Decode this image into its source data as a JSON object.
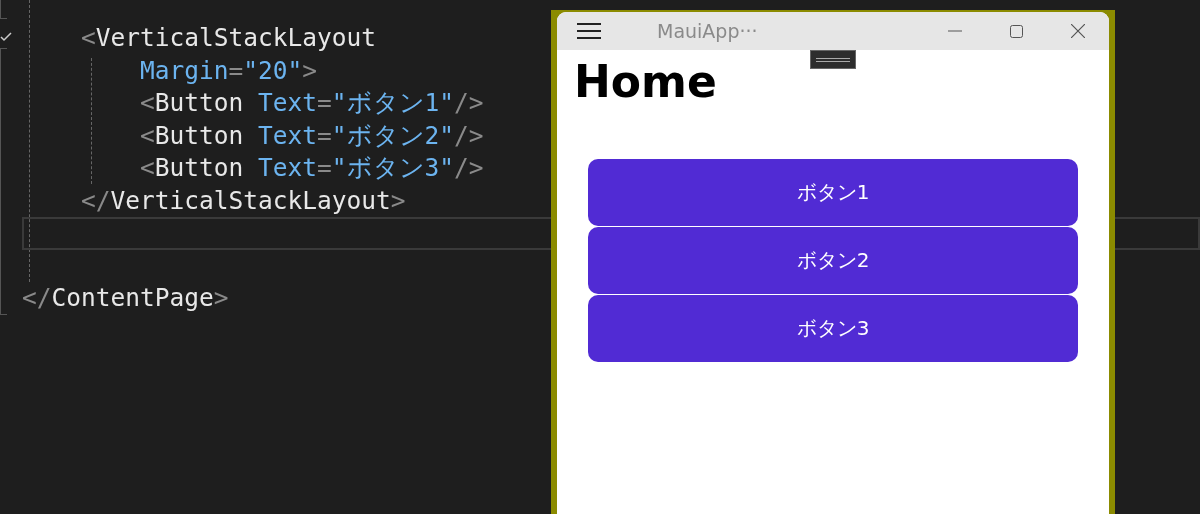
{
  "editor": {
    "lines": [
      {
        "tokens": [
          {
            "kind": "punct",
            "text": "    <"
          },
          {
            "kind": "tag",
            "text": "VerticalStackLayout"
          }
        ]
      },
      {
        "tokens": [
          {
            "kind": "attr",
            "text": "        Margin"
          },
          {
            "kind": "punct",
            "text": "="
          },
          {
            "kind": "value",
            "text": "\"20\""
          },
          {
            "kind": "punct",
            "text": ">"
          }
        ]
      },
      {
        "tokens": [
          {
            "kind": "punct",
            "text": "        <"
          },
          {
            "kind": "tag",
            "text": "Button"
          },
          {
            "kind": "attr",
            "text": " Text"
          },
          {
            "kind": "punct",
            "text": "="
          },
          {
            "kind": "value",
            "text": "\"ボタン1\""
          },
          {
            "kind": "punct",
            "text": "/>"
          }
        ]
      },
      {
        "tokens": [
          {
            "kind": "punct",
            "text": "        <"
          },
          {
            "kind": "tag",
            "text": "Button"
          },
          {
            "kind": "attr",
            "text": " Text"
          },
          {
            "kind": "punct",
            "text": "="
          },
          {
            "kind": "value",
            "text": "\"ボタン2\""
          },
          {
            "kind": "punct",
            "text": "/>"
          }
        ]
      },
      {
        "tokens": [
          {
            "kind": "punct",
            "text": "        <"
          },
          {
            "kind": "tag",
            "text": "Button"
          },
          {
            "kind": "attr",
            "text": " Text"
          },
          {
            "kind": "punct",
            "text": "="
          },
          {
            "kind": "value",
            "text": "\"ボタン3\""
          },
          {
            "kind": "punct",
            "text": "/>"
          }
        ]
      },
      {
        "tokens": [
          {
            "kind": "punct",
            "text": "    </"
          },
          {
            "kind": "tag",
            "text": "VerticalStackLayout"
          },
          {
            "kind": "punct",
            "text": ">"
          }
        ]
      },
      {
        "current": true
      },
      {
        "current": false
      },
      {
        "tokens": [
          {
            "kind": "punct",
            "text": "</"
          },
          {
            "kind": "tag",
            "text": "ContentPage"
          },
          {
            "kind": "punct",
            "text": ">"
          }
        ]
      }
    ]
  },
  "app_window": {
    "title": "MauiApp···",
    "page_title": "Home",
    "buttons": [
      "ボタン1",
      "ボタン2",
      "ボタン3"
    ]
  }
}
